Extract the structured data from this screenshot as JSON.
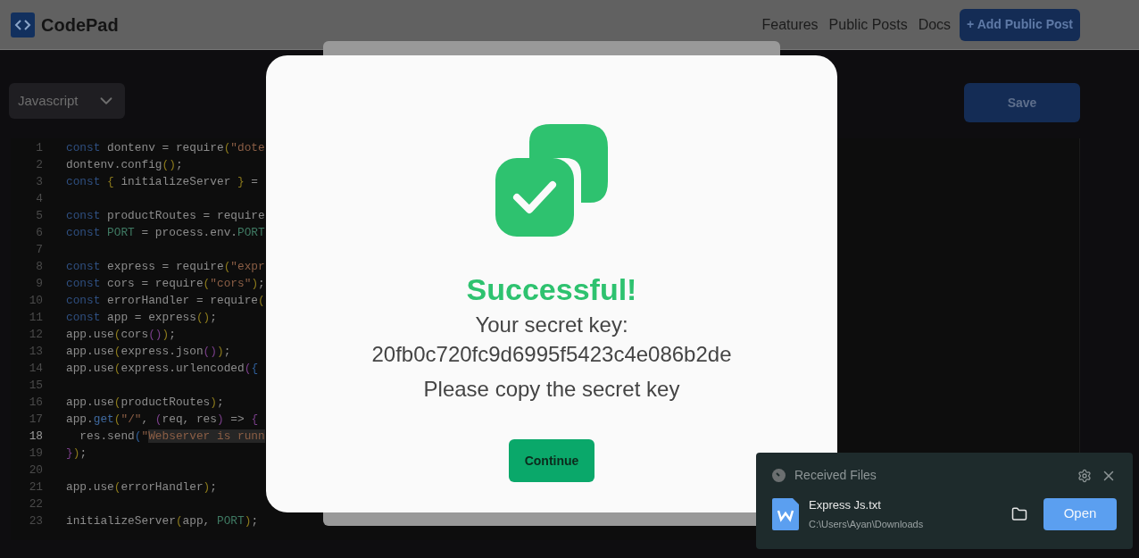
{
  "header": {
    "logo": "CodePad",
    "nav": [
      "Features",
      "Public Posts",
      "Docs"
    ],
    "add_button": "+ Add Public Post"
  },
  "toolbar": {
    "language": "Javascript",
    "save": "Save"
  },
  "editor": {
    "lines": [
      {
        "number": "1",
        "selected": false,
        "tokens": [
          {
            "kind": "kw",
            "text": "const"
          },
          {
            "kind": "id",
            "text": " dontenv = require"
          },
          {
            "kind": "br",
            "text": "("
          },
          {
            "kind": "str",
            "text": "\"dote"
          }
        ]
      },
      {
        "number": "2",
        "selected": false,
        "tokens": [
          {
            "kind": "id",
            "text": "dontenv.config"
          },
          {
            "kind": "br",
            "text": "()"
          },
          {
            "kind": "id",
            "text": ";"
          }
        ]
      },
      {
        "number": "3",
        "selected": false,
        "tokens": [
          {
            "kind": "kw",
            "text": "const"
          },
          {
            "kind": "br",
            "text": " {"
          },
          {
            "kind": "id",
            "text": " initializeServer "
          },
          {
            "kind": "br",
            "text": "}"
          },
          {
            "kind": "id",
            "text": " ="
          }
        ]
      },
      {
        "number": "4",
        "selected": false
      },
      {
        "number": "5",
        "selected": false,
        "tokens": [
          {
            "kind": "kw",
            "text": "const"
          },
          {
            "kind": "id",
            "text": " productRoutes = require"
          }
        ]
      },
      {
        "number": "6",
        "selected": false,
        "tokens": [
          {
            "kind": "kw",
            "text": "const"
          },
          {
            "kind": "cn",
            "text": " PORT"
          },
          {
            "kind": "id",
            "text": " = process.env."
          },
          {
            "kind": "cn",
            "text": "PORT"
          }
        ]
      },
      {
        "number": "7",
        "selected": false
      },
      {
        "number": "8",
        "selected": false,
        "tokens": [
          {
            "kind": "kw",
            "text": "const"
          },
          {
            "kind": "id",
            "text": " express = require"
          },
          {
            "kind": "br",
            "text": "("
          },
          {
            "kind": "str",
            "text": "\"expr"
          }
        ]
      },
      {
        "number": "9",
        "selected": false,
        "tokens": [
          {
            "kind": "kw",
            "text": "const"
          },
          {
            "kind": "id",
            "text": " cors = require"
          },
          {
            "kind": "br",
            "text": "("
          },
          {
            "kind": "str",
            "text": "\"cors\""
          },
          {
            "kind": "br",
            "text": ")"
          },
          {
            "kind": "id",
            "text": ";"
          }
        ]
      },
      {
        "number": "10",
        "selected": false,
        "tokens": [
          {
            "kind": "kw",
            "text": "const"
          },
          {
            "kind": "id",
            "text": " errorHandler = require"
          },
          {
            "kind": "br",
            "text": "("
          }
        ]
      },
      {
        "number": "11",
        "selected": false,
        "tokens": [
          {
            "kind": "kw",
            "text": "const"
          },
          {
            "kind": "id",
            "text": " app = express"
          },
          {
            "kind": "br",
            "text": "()"
          },
          {
            "kind": "id",
            "text": ";"
          }
        ]
      },
      {
        "number": "12",
        "selected": false,
        "tokens": [
          {
            "kind": "id",
            "text": "app.use"
          },
          {
            "kind": "br",
            "text": "("
          },
          {
            "kind": "id",
            "text": "cors"
          },
          {
            "kind": "br2",
            "text": "()"
          },
          {
            "kind": "br",
            "text": ")"
          },
          {
            "kind": "id",
            "text": ";"
          }
        ]
      },
      {
        "number": "13",
        "selected": false,
        "tokens": [
          {
            "kind": "id",
            "text": "app.use"
          },
          {
            "kind": "br",
            "text": "("
          },
          {
            "kind": "id",
            "text": "express.json"
          },
          {
            "kind": "br2",
            "text": "()"
          },
          {
            "kind": "br",
            "text": ")"
          },
          {
            "kind": "id",
            "text": ";"
          }
        ]
      },
      {
        "number": "14",
        "selected": false,
        "tokens": [
          {
            "kind": "id",
            "text": "app.use"
          },
          {
            "kind": "br",
            "text": "("
          },
          {
            "kind": "id",
            "text": "express.urlencoded"
          },
          {
            "kind": "br2",
            "text": "("
          },
          {
            "kind": "br3",
            "text": "{"
          }
        ]
      },
      {
        "number": "15",
        "selected": false
      },
      {
        "number": "16",
        "selected": false,
        "tokens": [
          {
            "kind": "id",
            "text": "app.use"
          },
          {
            "kind": "br",
            "text": "("
          },
          {
            "kind": "id",
            "text": "productRoutes"
          },
          {
            "kind": "br",
            "text": ")"
          },
          {
            "kind": "id",
            "text": ";"
          }
        ]
      },
      {
        "number": "17",
        "selected": false,
        "tokens": [
          {
            "kind": "id",
            "text": "app."
          },
          {
            "kind": "fn",
            "text": "get"
          },
          {
            "kind": "br",
            "text": "("
          },
          {
            "kind": "str",
            "text": "\"/\""
          },
          {
            "kind": "id",
            "text": ","
          },
          {
            "kind": "br2",
            "text": " ("
          },
          {
            "kind": "id",
            "text": "req, res"
          },
          {
            "kind": "br2",
            "text": ")"
          },
          {
            "kind": "id",
            "text": " => "
          },
          {
            "kind": "br2",
            "text": "{"
          }
        ]
      },
      {
        "number": "18",
        "selected": true,
        "tokens": [
          {
            "kind": "id",
            "text": "  res.send"
          },
          {
            "kind": "br3",
            "text": "("
          },
          {
            "kind": "str",
            "text": "\""
          },
          {
            "kind": "sel",
            "text": "Webserver is runn"
          }
        ]
      },
      {
        "number": "19",
        "selected": false,
        "tokens": [
          {
            "kind": "br2",
            "text": "}"
          },
          {
            "kind": "br",
            "text": ")"
          },
          {
            "kind": "id",
            "text": ";"
          }
        ]
      },
      {
        "number": "20",
        "selected": false
      },
      {
        "number": "21",
        "selected": false,
        "tokens": [
          {
            "kind": "id",
            "text": "app.use"
          },
          {
            "kind": "br",
            "text": "("
          },
          {
            "kind": "id",
            "text": "errorHandler"
          },
          {
            "kind": "br",
            "text": ")"
          },
          {
            "kind": "id",
            "text": ";"
          }
        ]
      },
      {
        "number": "22",
        "selected": false
      },
      {
        "number": "23",
        "selected": false,
        "tokens": [
          {
            "kind": "id",
            "text": "initializeServer"
          },
          {
            "kind": "br",
            "text": "("
          },
          {
            "kind": "id",
            "text": "app, "
          },
          {
            "kind": "cn",
            "text": "PORT"
          },
          {
            "kind": "br",
            "text": ")"
          },
          {
            "kind": "id",
            "text": ";"
          }
        ]
      }
    ]
  },
  "modal": {
    "title": "Successful!",
    "key_label": "Your secret key:",
    "key": "20fb0c720fc9d6995f5423c4e086b2de",
    "note": "Please copy the secret key",
    "button": "Continue"
  },
  "notification": {
    "title": "Received Files",
    "file_name": "Express Js.txt",
    "path": "C:\\Users\\Ayan\\Downloads",
    "button": "Open"
  }
}
